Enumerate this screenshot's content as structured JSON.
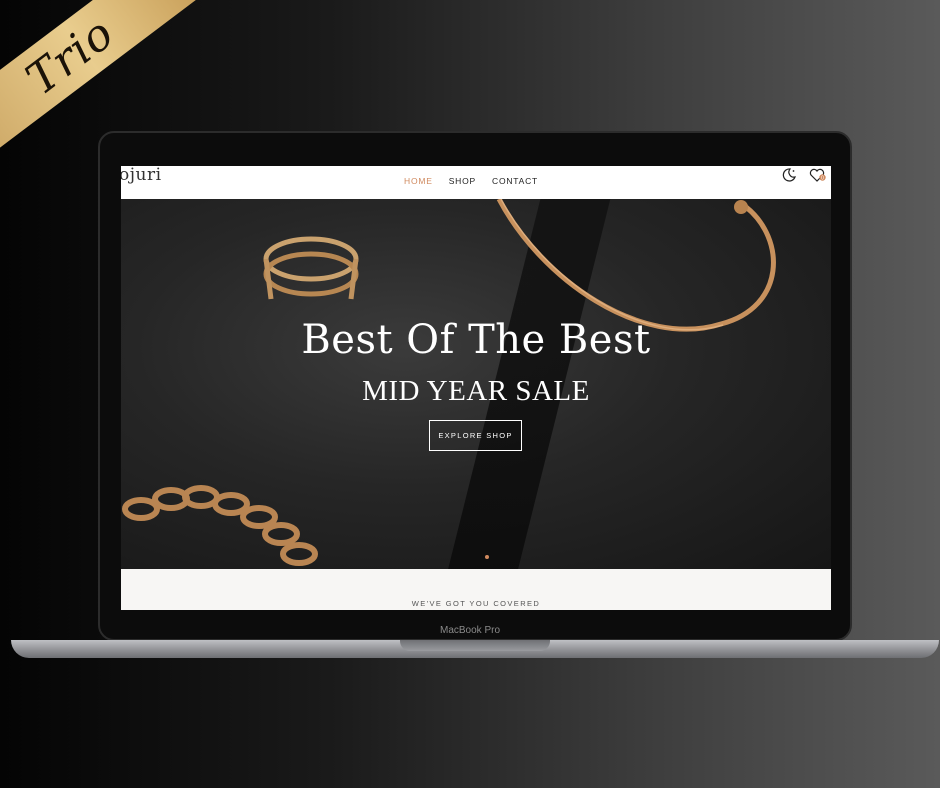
{
  "badge": {
    "text": "Trio"
  },
  "site": {
    "logo": "ojuri",
    "nav": [
      {
        "label": "HOME",
        "active": true
      },
      {
        "label": "SHOP",
        "active": false
      },
      {
        "label": "CONTACT",
        "active": false
      }
    ],
    "icons": [
      "moon-icon",
      "wishlist-icon"
    ],
    "cart_count": "0"
  },
  "hero": {
    "title": "Best Of The Best",
    "subtitle": "MID YEAR SALE",
    "button": "EXPLORE SHOP"
  },
  "section": {
    "tagline": "WE'VE GOT YOU COVERED"
  },
  "device": {
    "label": "MacBook Pro"
  },
  "colors": {
    "accent": "#d08a5f",
    "gold": "#c9a05a"
  }
}
